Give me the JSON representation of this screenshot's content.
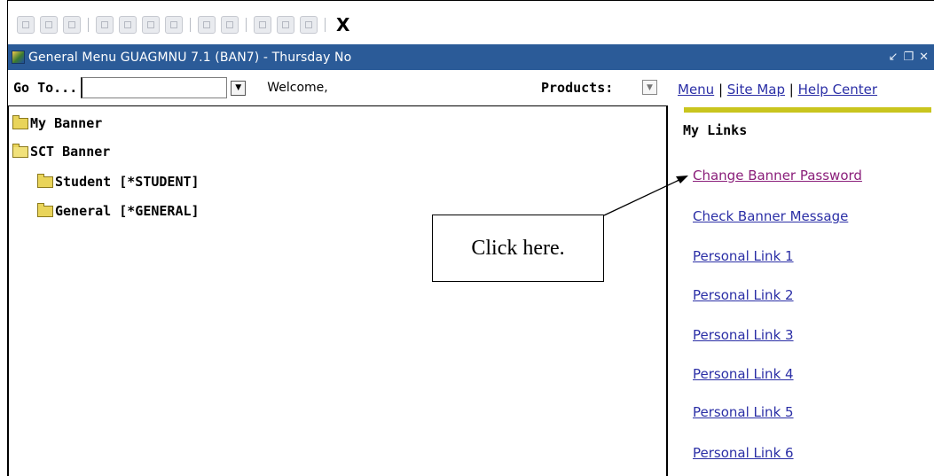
{
  "toolbar": {
    "icons": [
      "save-icon",
      "rollback-icon",
      "page-icon",
      "insert-icon",
      "remove-icon",
      "print-icon",
      "block-icon",
      "enter-query-icon",
      "execute-query-icon",
      "help-icon",
      "db-icon",
      "cancel-icon"
    ],
    "exit_label": "X"
  },
  "window": {
    "title": "General Menu  GUAGMNU  7.1  (BAN7) - Thursday No",
    "controls": [
      "↙",
      "❐",
      "✕"
    ]
  },
  "goto": {
    "label": "Go To...",
    "value": "",
    "welcome": "Welcome,"
  },
  "products": {
    "label": "Products:"
  },
  "tree": {
    "items": [
      {
        "label": "My Banner",
        "open": false
      },
      {
        "label": "SCT Banner",
        "open": true
      },
      {
        "label": "Student [*STUDENT]",
        "open": false
      },
      {
        "label": "General [*GENERAL]",
        "open": false
      }
    ]
  },
  "top_links": {
    "menu": "Menu",
    "sep1": " | ",
    "site_map": "Site Map",
    "sep2": " | ",
    "help_center": "Help Center"
  },
  "my_links": {
    "heading": "My Links",
    "items": [
      "Change Banner Password",
      "Check Banner Message",
      "Personal Link 1",
      "Personal Link 2",
      "Personal Link 3",
      "Personal Link 4",
      "Personal Link 5",
      "Personal Link 6"
    ]
  },
  "callout": {
    "text": "Click here."
  },
  "colors": {
    "titlebar": "#2b5b98",
    "accent_bar": "#c9c51e",
    "link": "#2b2fa6",
    "visited_link": "#8a1e7a"
  }
}
